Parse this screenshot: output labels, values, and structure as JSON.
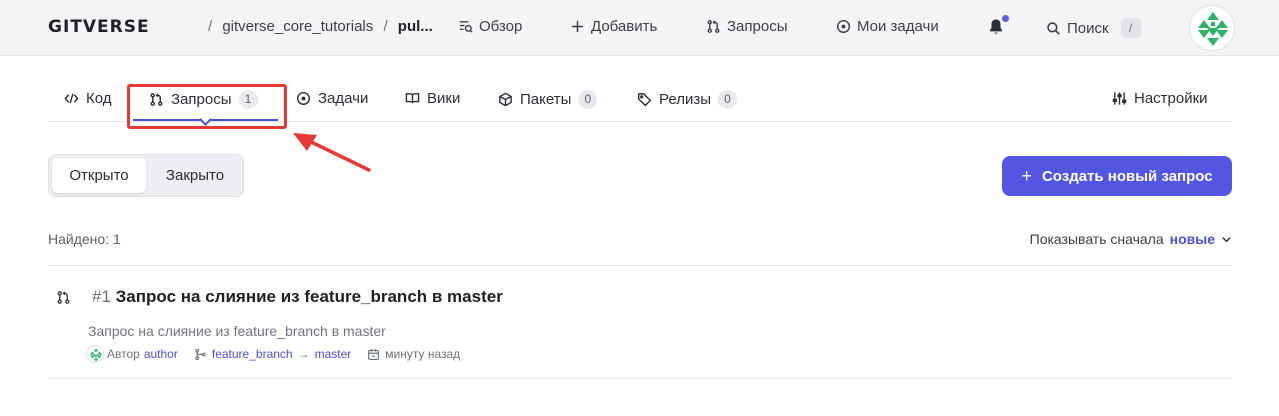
{
  "header": {
    "logo": "GITVERSE",
    "breadcrumb": {
      "owner": "gitverse_core_tutorials",
      "repo": "pul...",
      "separator": "/"
    },
    "nav": {
      "overview": "Обзор",
      "add": "Добавить",
      "requests": "Запросы",
      "my_tasks": "Мои задачи",
      "search": "Поиск",
      "search_shortcut": "/"
    }
  },
  "tabs": [
    {
      "label": "Код"
    },
    {
      "label": "Запросы",
      "count": "1",
      "active": true
    },
    {
      "label": "Задачи"
    },
    {
      "label": "Вики"
    },
    {
      "label": "Пакеты",
      "count": "0"
    },
    {
      "label": "Релизы",
      "count": "0"
    },
    {
      "label": "Настройки"
    }
  ],
  "filter": {
    "open": "Открыто",
    "closed": "Закрыто"
  },
  "create_button": "Создать новый запрос",
  "results": {
    "found": "Найдено: 1",
    "sort_label": "Показывать сначала",
    "sort_value": "новые"
  },
  "pull_requests": [
    {
      "number": "#1",
      "title": "Запрос на слияние из feature_branch в master",
      "description": "Запрос на слияние из feature_branch в master",
      "author_label": "Автор",
      "author": "author",
      "source_branch": "feature_branch",
      "arrow": "→",
      "target_branch": "master",
      "time": "минуту назад"
    }
  ],
  "colors": {
    "accent": "#5356e3",
    "annotation": "#e53935",
    "header_bg": "#f3f4f6"
  },
  "icons": [
    "code-icon",
    "pull-request-icon",
    "issue-circle-icon",
    "book-icon",
    "package-icon",
    "tag-icon",
    "settings-sliders-icon",
    "bell-icon",
    "search-icon",
    "plus-icon",
    "branch-icon",
    "calendar-icon",
    "chevron-down-icon"
  ]
}
